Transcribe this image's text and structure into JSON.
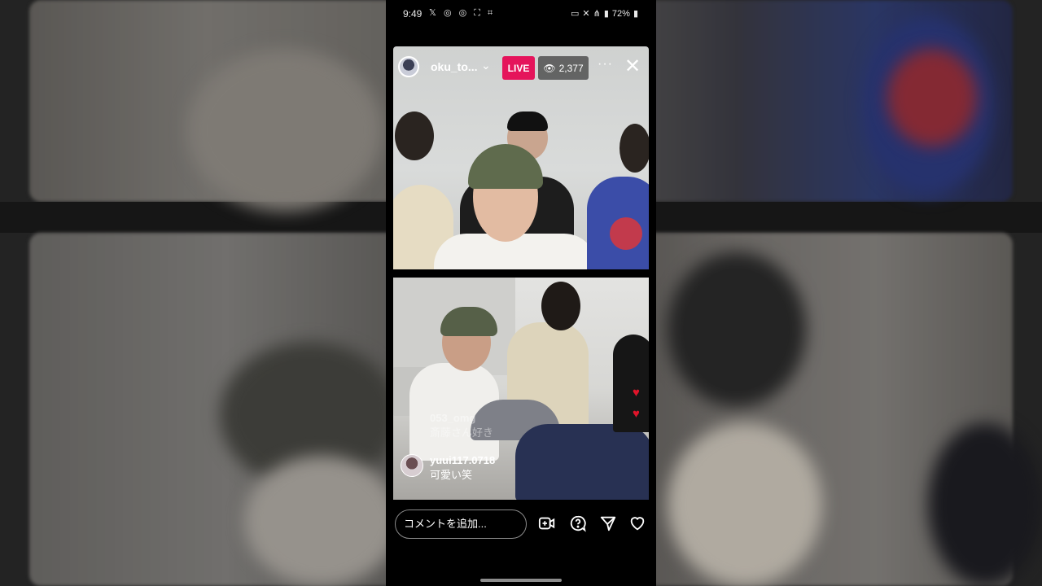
{
  "status_bar": {
    "time": "9:49",
    "left_icons": [
      "x-icon",
      "instagram-icon",
      "instagram-icon",
      "scan-icon",
      "focus-icon"
    ],
    "right_icons": [
      "sleep-icon",
      "mute-icon",
      "wifi-icon",
      "signal-icon",
      "battery-icon"
    ],
    "battery": "72%"
  },
  "live": {
    "username": "oku_to...",
    "live_label": "LIVE",
    "viewer_count": "2,377",
    "more_label": "···",
    "close_label": "✕"
  },
  "comments": [
    {
      "username": "053_omg",
      "text": "斎藤さん好き",
      "faded": true
    },
    {
      "username": "yuui117.0718",
      "text": "可愛い笑",
      "faded": false
    }
  ],
  "composer": {
    "placeholder": "コメントを追加..."
  },
  "colors": {
    "live_badge": "#e5145b",
    "heart": "#e0142a",
    "phone_bg": "#000000"
  }
}
